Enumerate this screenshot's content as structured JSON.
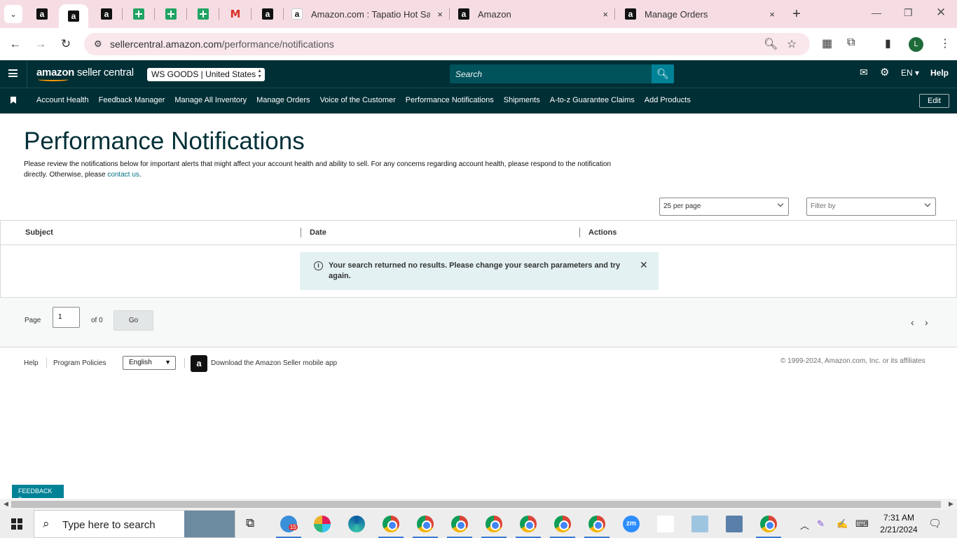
{
  "browser": {
    "tabs": [
      {
        "title": "Amazon.com : Tapatio Hot Sauc",
        "close": "×"
      },
      {
        "title": "Amazon",
        "close": "×"
      },
      {
        "title": "Manage Orders",
        "close": "×"
      }
    ],
    "new_tab": "+",
    "url_host": "sellercentral.amazon.com",
    "url_path": "/performance/notifications",
    "profile_initial": "L"
  },
  "header": {
    "logo_brand": "amazon",
    "logo_product": " seller central",
    "store": "WS GOODS | United States",
    "search_placeholder": "Search",
    "language": "EN ▾",
    "help": "Help"
  },
  "nav": {
    "items": [
      "Account Health",
      "Feedback Manager",
      "Manage All Inventory",
      "Manage Orders",
      "Voice of the Customer",
      "Performance Notifications",
      "Shipments",
      "A-to-z Guarantee Claims",
      "Add Products"
    ],
    "edit": "Edit"
  },
  "main": {
    "title": "Performance Notifications",
    "description": "Please review the notifications below for important alerts that might affect your account health and ability to sell. For any concerns regarding account health, please respond to the notification directly. Otherwise, please ",
    "contact_link": "contact us",
    "description_end": ".",
    "per_page": "25 per page",
    "filter_placeholder": "Filter by",
    "columns": [
      "Subject",
      "Date",
      "Actions"
    ],
    "alert_message": "Your search returned no results. Please change your search parameters and try again."
  },
  "pager": {
    "page_label": "Page",
    "page_value": "1",
    "of_label": "of 0",
    "go": "Go"
  },
  "footer": {
    "help": "Help",
    "program_policies": "Program Policies",
    "language": "English",
    "app_text": "Download the Amazon Seller mobile app",
    "copyright": "© 1999-2024, Amazon.com, Inc. or its affiliates"
  },
  "feedback": "FEEDBACK ×",
  "taskbar": {
    "search_placeholder": "Type here to search",
    "badge_count": "15",
    "time": "7:31 AM",
    "date": "2/21/2024"
  },
  "colors": {
    "header_bg": "#002f36",
    "search_btn": "#008296",
    "alert_bg": "#e3f1f2",
    "link": "#007185",
    "tabstrip": "#f6dde4"
  }
}
